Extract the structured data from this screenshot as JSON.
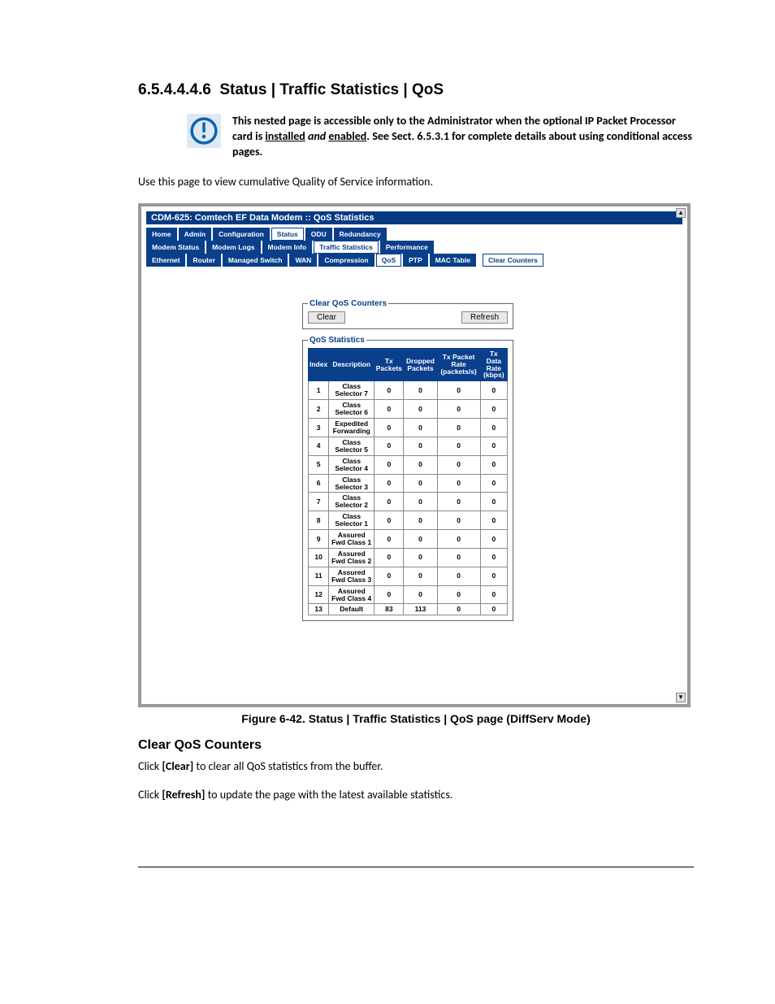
{
  "section": {
    "number": "6.5.4.4.4.6",
    "title": "Status | Traffic Statistics | QoS"
  },
  "note": {
    "p1": "This nested page is accessible only to the Administrator when the optional IP Packet Processor card is ",
    "u1": "installed",
    "i1": " and ",
    "u2": "enabled",
    "p2": ". See Sect. 6.5.3.1 for complete details about using conditional access pages."
  },
  "intro": "Use this page to view cumulative Quality of Service information.",
  "screenshot": {
    "title": "CDM-625: Comtech EF Data Modem :: QoS Statistics",
    "tabs_row1": [
      "Home",
      "Admin",
      "Configuration",
      "Status",
      "ODU",
      "Redundancy"
    ],
    "tabs_row1_active_idx": 3,
    "tabs_row2": [
      "Modem Status",
      "Modem Logs",
      "Modem Info",
      "Traffic Statistics",
      "Performance"
    ],
    "tabs_row2_active_idx": 3,
    "tabs_row3": [
      "Ethernet",
      "Router",
      "Managed Switch",
      "WAN",
      "Compression",
      "QoS",
      "PTP",
      "MAC Table"
    ],
    "tabs_row3_active_idx": 5,
    "clear_counters_link": "Clear Counters",
    "fs_clear_legend": "Clear QoS Counters",
    "btn_clear": "Clear",
    "btn_refresh": "Refresh",
    "fs_stats_legend": "QoS Statistics",
    "columns": [
      "Index",
      "Description",
      "Tx Packets",
      "Dropped Packets",
      "Tx Packet Rate (packets/s)",
      "Tx Data Rate (kbps)"
    ]
  },
  "chart_data": {
    "type": "table",
    "columns": [
      "Index",
      "Description",
      "Tx Packets",
      "Dropped Packets",
      "Tx Packet Rate (packets/s)",
      "Tx Data Rate (kbps)"
    ],
    "rows": [
      {
        "index": 1,
        "description": "Class Selector 7",
        "tx_packets": 0,
        "dropped_packets": 0,
        "tx_packet_rate": 0,
        "tx_data_rate": 0
      },
      {
        "index": 2,
        "description": "Class Selector 6",
        "tx_packets": 0,
        "dropped_packets": 0,
        "tx_packet_rate": 0,
        "tx_data_rate": 0
      },
      {
        "index": 3,
        "description": "Expedited Forwarding",
        "tx_packets": 0,
        "dropped_packets": 0,
        "tx_packet_rate": 0,
        "tx_data_rate": 0
      },
      {
        "index": 4,
        "description": "Class Selector 5",
        "tx_packets": 0,
        "dropped_packets": 0,
        "tx_packet_rate": 0,
        "tx_data_rate": 0
      },
      {
        "index": 5,
        "description": "Class Selector 4",
        "tx_packets": 0,
        "dropped_packets": 0,
        "tx_packet_rate": 0,
        "tx_data_rate": 0
      },
      {
        "index": 6,
        "description": "Class Selector 3",
        "tx_packets": 0,
        "dropped_packets": 0,
        "tx_packet_rate": 0,
        "tx_data_rate": 0
      },
      {
        "index": 7,
        "description": "Class Selector 2",
        "tx_packets": 0,
        "dropped_packets": 0,
        "tx_packet_rate": 0,
        "tx_data_rate": 0
      },
      {
        "index": 8,
        "description": "Class Selector 1",
        "tx_packets": 0,
        "dropped_packets": 0,
        "tx_packet_rate": 0,
        "tx_data_rate": 0
      },
      {
        "index": 9,
        "description": "Assured Fwd Class 1",
        "tx_packets": 0,
        "dropped_packets": 0,
        "tx_packet_rate": 0,
        "tx_data_rate": 0
      },
      {
        "index": 10,
        "description": "Assured Fwd Class 2",
        "tx_packets": 0,
        "dropped_packets": 0,
        "tx_packet_rate": 0,
        "tx_data_rate": 0
      },
      {
        "index": 11,
        "description": "Assured Fwd Class 3",
        "tx_packets": 0,
        "dropped_packets": 0,
        "tx_packet_rate": 0,
        "tx_data_rate": 0
      },
      {
        "index": 12,
        "description": "Assured Fwd Class 4",
        "tx_packets": 0,
        "dropped_packets": 0,
        "tx_packet_rate": 0,
        "tx_data_rate": 0
      },
      {
        "index": 13,
        "description": "Default",
        "tx_packets": 83,
        "dropped_packets": 113,
        "tx_packet_rate": 0,
        "tx_data_rate": 0
      }
    ]
  },
  "figure_caption": "Figure 6-42. Status | Traffic Statistics | QoS page (DiffServ Mode)",
  "subheading": "Clear QoS Counters",
  "p_clear": {
    "pre": "Click ",
    "b": "[Clear]",
    "post": " to clear all QoS statistics from the buffer."
  },
  "p_refresh": {
    "pre": "Click ",
    "b": "[Refresh]",
    "post": " to update the page with the latest available statistics."
  }
}
